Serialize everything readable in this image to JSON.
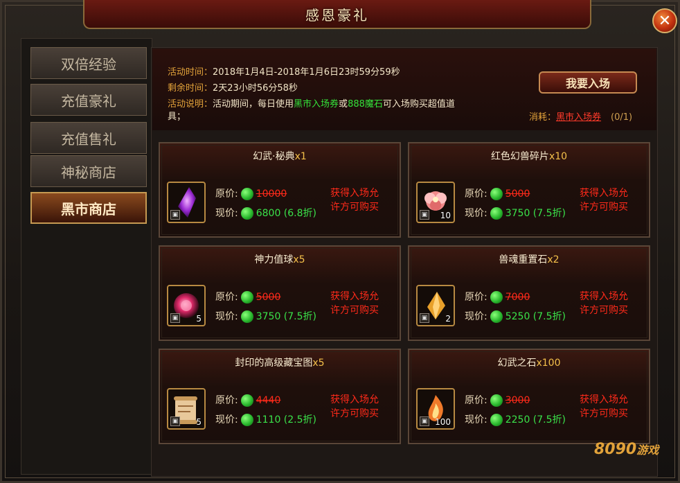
{
  "window": {
    "title": "感恩豪礼",
    "close_label": "✕"
  },
  "sidebar": {
    "items": [
      {
        "label": "双倍经验"
      },
      {
        "label": "充值豪礼"
      },
      {
        "label": "充值售礼"
      },
      {
        "label": "神秘商店"
      },
      {
        "label": "黑市商店",
        "active": true
      }
    ]
  },
  "info": {
    "time_key": "活动时间：",
    "time_val": "2018年1月4日-2018年1月6日23时59分59秒",
    "remain_key": "剩余时间：",
    "remain_val": "2天23小时56分58秒",
    "desc_key": "活动说明：",
    "desc_pre": "活动期间，每日使用",
    "desc_ticket": "黑市入场券",
    "desc_or": "或",
    "desc_stone": "888魔石",
    "desc_post": "可入场购买超值道",
    "desc_wrap": "具；"
  },
  "enter_button": "我要入场",
  "cost": {
    "key": "消耗：",
    "value": "黑市入场券",
    "count": "(0/1)"
  },
  "labels": {
    "orig": "原价:",
    "now": "现价:",
    "req_line1": "获得入场允",
    "req_line2": "许方可购买"
  },
  "items": [
    {
      "name": "幻武·秘典",
      "mult": "x1",
      "orig": "10000",
      "now": "6800 (6.8折)",
      "qty": "",
      "icon": "purple-gem-icon"
    },
    {
      "name": "红色幻兽碎片",
      "mult": "x10",
      "orig": "5000",
      "now": "3750 (7.5折)",
      "qty": "10",
      "icon": "flower-icon"
    },
    {
      "name": "神力值球",
      "mult": "x5",
      "orig": "5000",
      "now": "3750 (7.5折)",
      "qty": "5",
      "icon": "power-orb-icon"
    },
    {
      "name": "兽魂重置石",
      "mult": "x2",
      "orig": "7000",
      "now": "5250 (7.5折)",
      "qty": "2",
      "icon": "beast-stone-icon"
    },
    {
      "name": "封印的高级藏宝图",
      "mult": "x5",
      "orig": "4440",
      "now": "1110 (2.5折)",
      "qty": "5",
      "icon": "treasure-map-icon"
    },
    {
      "name": "幻武之石",
      "mult": "x100",
      "orig": "3000",
      "now": "2250 (7.5折)",
      "qty": "100",
      "icon": "fire-stone-icon"
    }
  ],
  "logo": {
    "text": "8090",
    "sub": "游戏"
  }
}
